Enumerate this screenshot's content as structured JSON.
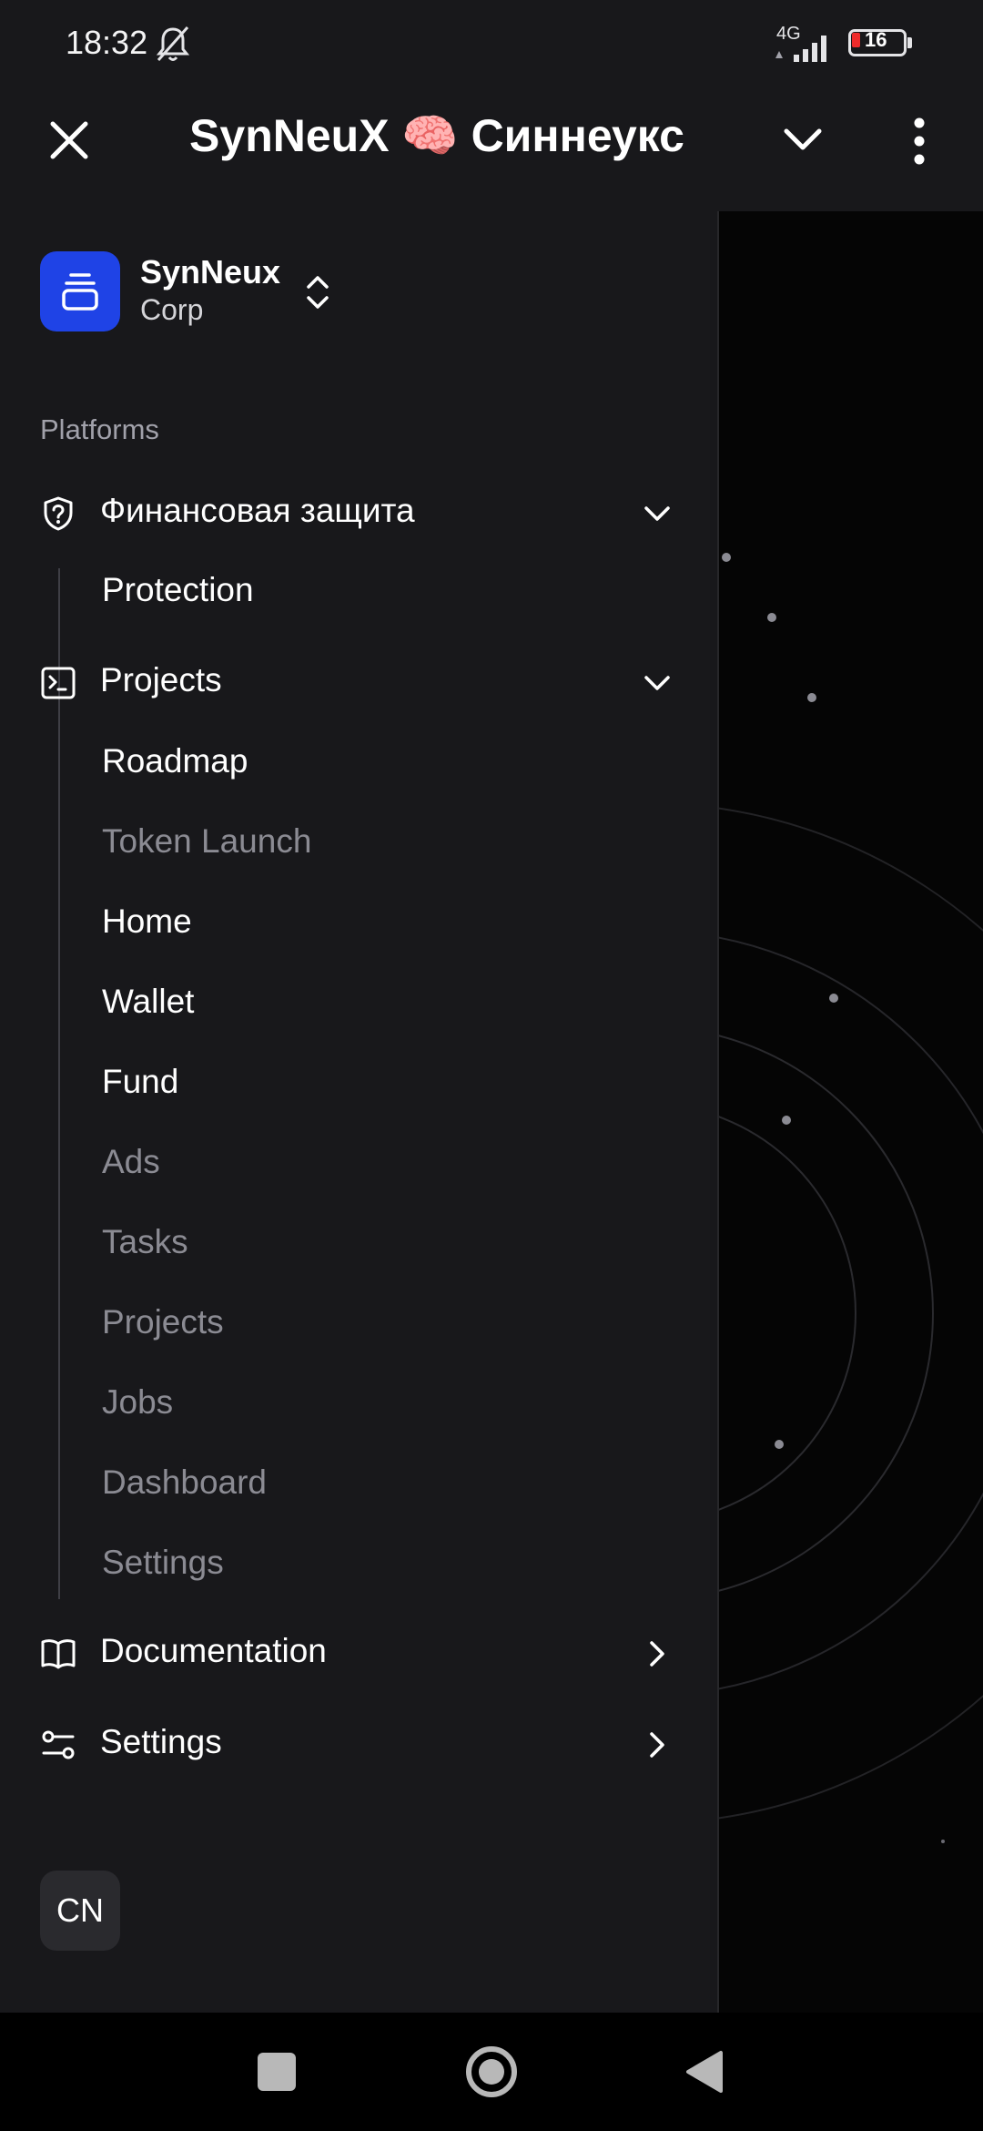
{
  "status": {
    "time": "18:32",
    "network": "4G",
    "battery": "16",
    "battery_color": "#ef2b2b"
  },
  "header": {
    "title": "SynNeuX 🧠 Синнеукс",
    "close_icon": "close-icon",
    "chevron_icon": "chevron-down-icon",
    "more_icon": "more-vertical-icon"
  },
  "org": {
    "name": "SynNeux",
    "subtitle": "Corp",
    "logo_color": "#1f43e6"
  },
  "sidebar": {
    "section_label": "Platforms",
    "groups": [
      {
        "label": "Финансовая защита",
        "icon": "shield-question-icon",
        "expanded": true,
        "items": [
          {
            "label": "Protection",
            "active": true
          }
        ]
      },
      {
        "label": "Projects",
        "icon": "terminal-icon",
        "expanded": true,
        "items": [
          {
            "label": "Roadmap",
            "active": true
          },
          {
            "label": "Token Launch",
            "active": false
          },
          {
            "label": "Home",
            "active": true
          },
          {
            "label": "Wallet",
            "active": true
          },
          {
            "label": "Fund",
            "active": true
          },
          {
            "label": "Ads",
            "active": false
          },
          {
            "label": "Tasks",
            "active": false
          },
          {
            "label": "Projects",
            "active": false
          },
          {
            "label": "Jobs",
            "active": false
          },
          {
            "label": "Dashboard",
            "active": false
          },
          {
            "label": "Settings",
            "active": false
          }
        ]
      },
      {
        "label": "Documentation",
        "icon": "book-open-icon",
        "expanded": false,
        "items": []
      },
      {
        "label": "Settings",
        "icon": "sliders-icon",
        "expanded": false,
        "items": []
      }
    ]
  },
  "footer": {
    "avatar_initials": "CN"
  }
}
